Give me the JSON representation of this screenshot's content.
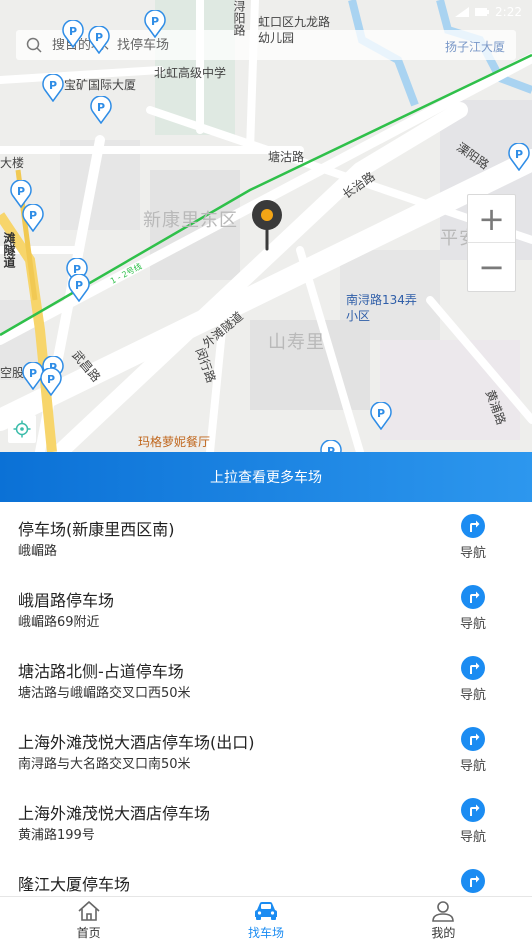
{
  "status": {
    "time": "2:22"
  },
  "search": {
    "placeholder": "搜目的地、找停车场"
  },
  "map": {
    "labels": {
      "road_xunyang": "浔阳路",
      "kindergarten": "虹口区九龙路幼儿园",
      "yangzijiang": "扬子江大厦",
      "baokuang": "宝矿国际大厦",
      "beihong": "北虹高级中学",
      "building_left": "大楼",
      "tanggu": "塘沽路",
      "changzhi": "长治路",
      "liyang": "溧阳路",
      "xinkangli": "新康里东区",
      "pingan": "平安里",
      "waitan_tunnel": "外滩隧道",
      "nanxun_134": "南浔路134弄小区",
      "shanshouli": "山寿里",
      "wuchang": "武昌路",
      "minhang": "闵行路",
      "konggu": "空股",
      "huangpu": "黄浦路",
      "tunnel_vert": "滩隧道",
      "margone": "玛格萝妮餐厅",
      "line_label": "1 - 2号线"
    },
    "zoom_in": "+",
    "zoom_out": "−"
  },
  "banner": {
    "text": "上拉查看更多车场"
  },
  "list": {
    "nav_label": "导航",
    "items": [
      {
        "name": "停车场(新康里西区南)",
        "addr": "峨嵋路"
      },
      {
        "name": "峨眉路停车场",
        "addr": "峨嵋路69附近"
      },
      {
        "name": "塘沽路北侧-占道停车场",
        "addr": "塘沽路与峨嵋路交叉口西50米"
      },
      {
        "name": "上海外滩茂悦大酒店停车场(出口)",
        "addr": "南浔路与大名路交叉口南50米"
      },
      {
        "name": "上海外滩茂悦大酒店停车场",
        "addr": "黄浦路199号"
      },
      {
        "name": "隆江大厦停车场",
        "addr": ""
      }
    ]
  },
  "tabs": [
    {
      "label": "首页",
      "icon": "home-icon"
    },
    {
      "label": "找车场",
      "icon": "car-icon"
    },
    {
      "label": "我的",
      "icon": "user-icon"
    }
  ],
  "colors": {
    "accent": "#1b8cf2",
    "line_green": "#2fc04a",
    "banner_start": "#0b71d6",
    "banner_end": "#2d97ee"
  }
}
